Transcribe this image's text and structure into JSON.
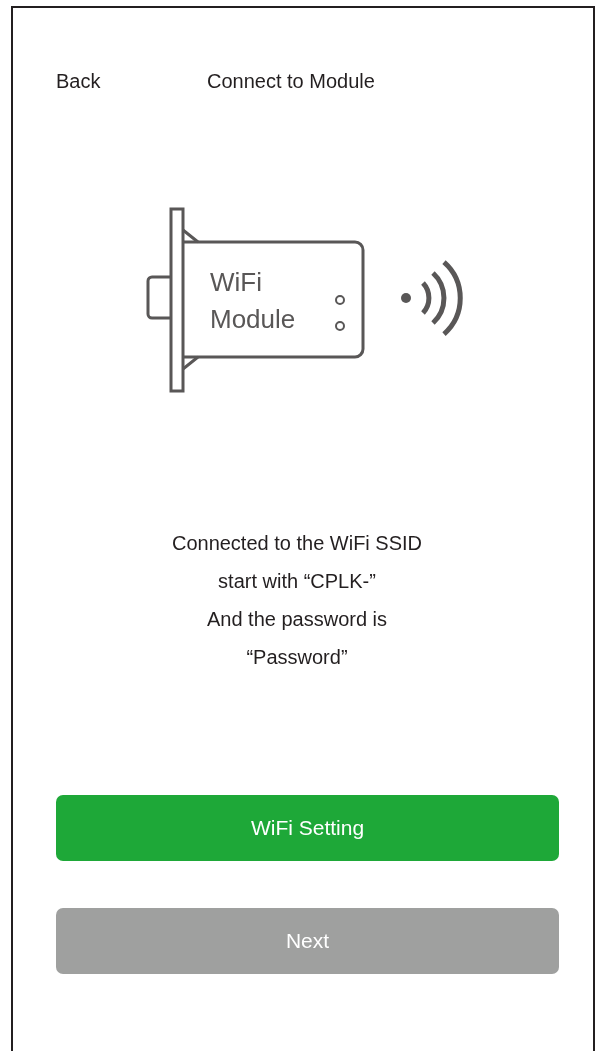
{
  "header": {
    "back": "Back",
    "title": "Connect to Module"
  },
  "illustration": {
    "label_lines": [
      "WiFi",
      "Module"
    ]
  },
  "message_lines": [
    "Connected to the WiFi SSID",
    "start with “CPLK-”",
    "And the password is",
    "“Password”"
  ],
  "buttons": [
    {
      "label": "WiFi Setting",
      "disabled": false
    },
    {
      "label": "Next",
      "disabled": true
    }
  ]
}
